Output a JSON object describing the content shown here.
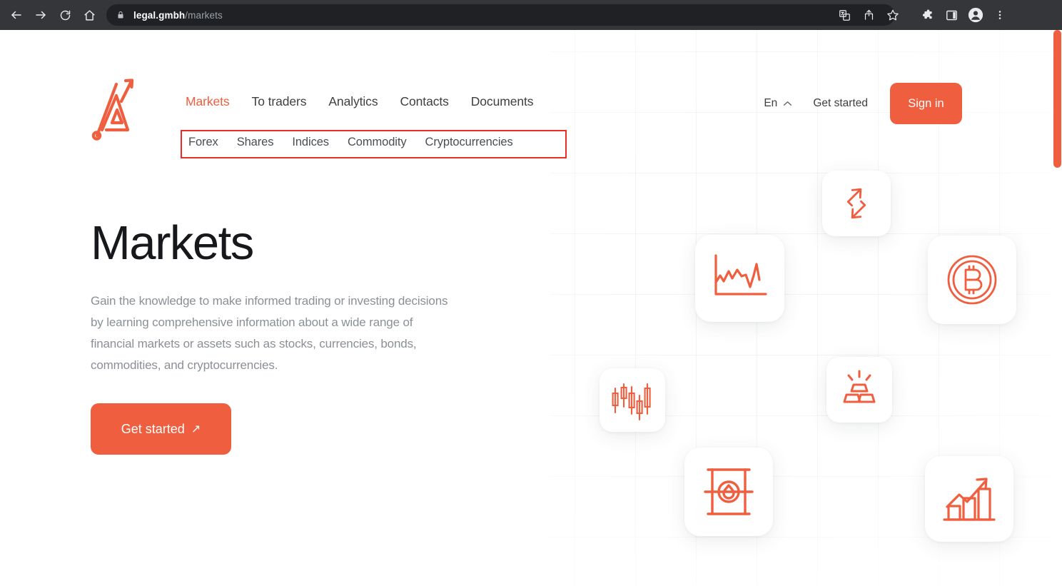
{
  "browser": {
    "back_icon": "back-arrow-icon",
    "forward_icon": "forward-arrow-icon",
    "reload_icon": "reload-icon",
    "home_icon": "home-icon",
    "lock_icon": "lock-icon",
    "url_host": "legal.gmbh",
    "url_path": "/markets",
    "translate_icon": "translate-icon",
    "share_icon": "share-icon",
    "bookmark_icon": "bookmark-star-icon",
    "extensions_icon": "extensions-puzzle-icon",
    "sidepanel_icon": "side-panel-icon",
    "profile_icon": "profile-avatar-icon",
    "menu_icon": "three-dot-menu-icon"
  },
  "site": {
    "logo_alt": "brand-logo",
    "main_nav": [
      {
        "label": "Markets",
        "active": true
      },
      {
        "label": "To traders",
        "active": false
      },
      {
        "label": "Analytics",
        "active": false
      },
      {
        "label": "Contacts",
        "active": false
      },
      {
        "label": "Documents",
        "active": false
      }
    ],
    "sub_nav": [
      {
        "label": "Forex"
      },
      {
        "label": "Shares"
      },
      {
        "label": "Indices"
      },
      {
        "label": "Commodity"
      },
      {
        "label": "Cryptocurrencies"
      }
    ],
    "language": "En",
    "language_chevron": "chevron-up-icon",
    "get_started_link": "Get started",
    "sign_in_label": "Sign in"
  },
  "hero": {
    "title": "Markets",
    "description": "Gain the knowledge to make informed trading or investing decisions by learning comprehensive information about a wide range of financial markets or assets such as stocks, currencies, bonds, commodities, and cryptocurrencies.",
    "cta_label": "Get started",
    "cta_arrow": "↗"
  },
  "illustration": {
    "cards": [
      {
        "name": "exchange-arrows-icon"
      },
      {
        "name": "line-chart-icon"
      },
      {
        "name": "bitcoin-coin-icon"
      },
      {
        "name": "candlestick-chart-icon"
      },
      {
        "name": "gold-bars-icon"
      },
      {
        "name": "oil-barrel-icon"
      },
      {
        "name": "growth-bar-chart-icon"
      }
    ]
  },
  "annotation": {
    "highlight_color": "#ee2b27",
    "target": "sub-nav"
  },
  "colors": {
    "accent": "#ef5e3e",
    "text_primary": "#16181b",
    "text_secondary": "#8b9096",
    "chrome_bg": "#35363a",
    "omnibox_bg": "#202124"
  }
}
